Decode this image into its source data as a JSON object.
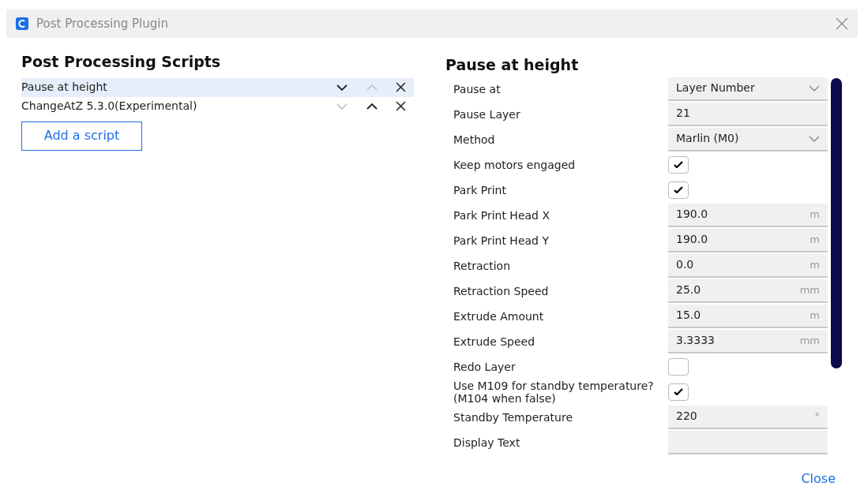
{
  "window": {
    "title": "Post Processing Plugin"
  },
  "scripts_panel": {
    "heading": "Post Processing Scripts",
    "add_button": "Add a script"
  },
  "scripts": [
    {
      "name": "Pause at height",
      "selected": true,
      "can_move_down": true,
      "can_move_up": false
    },
    {
      "name": "ChangeAtZ 5.3.0(Experimental)",
      "selected": false,
      "can_move_down": false,
      "can_move_up": true
    }
  ],
  "settings": {
    "heading": "Pause at height",
    "rows": [
      {
        "kind": "dropdown",
        "label": "Pause at",
        "value": "Layer Number"
      },
      {
        "kind": "number",
        "label": "Pause Layer",
        "value": "21"
      },
      {
        "kind": "dropdown",
        "label": "Method",
        "value": "Marlin (M0)"
      },
      {
        "kind": "checkbox",
        "label": "Keep motors engaged",
        "checked": true
      },
      {
        "kind": "checkbox",
        "label": "Park Print",
        "checked": true
      },
      {
        "kind": "number",
        "label": "Park Print Head X",
        "value": "190.0",
        "unit": "m"
      },
      {
        "kind": "number",
        "label": "Park Print Head Y",
        "value": "190.0",
        "unit": "m"
      },
      {
        "kind": "number",
        "label": "Retraction",
        "value": "0.0",
        "unit": "m"
      },
      {
        "kind": "number",
        "label": "Retraction Speed",
        "value": "25.0",
        "unit": "mm"
      },
      {
        "kind": "number",
        "label": "Extrude Amount",
        "value": "15.0",
        "unit": "m"
      },
      {
        "kind": "number",
        "label": "Extrude Speed",
        "value": "3.3333",
        "unit": "mm"
      },
      {
        "kind": "checkbox",
        "label": "Redo Layer",
        "checked": false
      },
      {
        "kind": "checkbox",
        "label": "Use M109 for standby temperature? (M104 when false)",
        "checked": true
      },
      {
        "kind": "number",
        "label": "Standby Temperature",
        "value": "220",
        "unit": "°"
      },
      {
        "kind": "text",
        "label": "Display Text"
      }
    ]
  },
  "buttons": {
    "close": "Close"
  }
}
